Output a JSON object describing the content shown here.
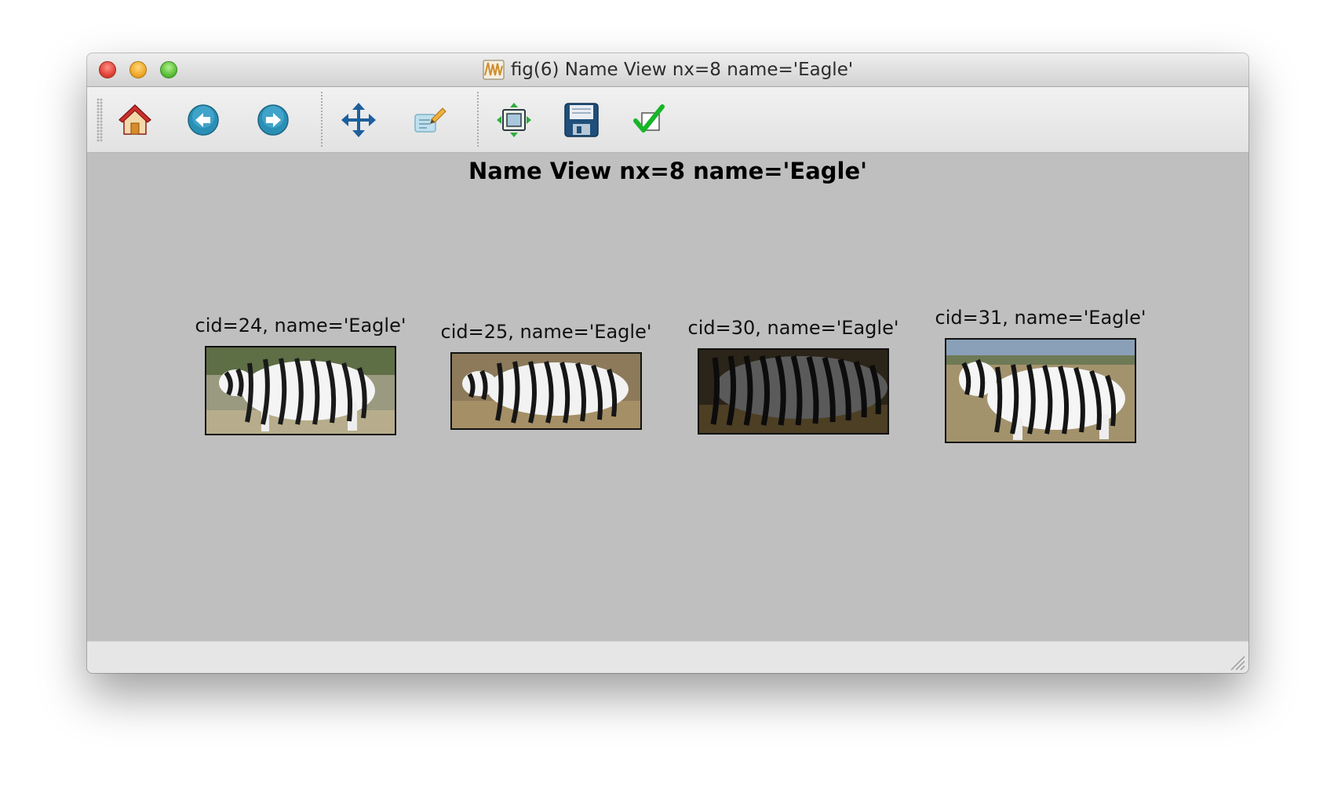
{
  "window": {
    "title": "fig(6) Name View nx=8 name='Eagle'"
  },
  "toolbar": {
    "buttons": [
      {
        "name": "home-icon",
        "tooltip": "Home"
      },
      {
        "name": "back-arrow-icon",
        "tooltip": "Back"
      },
      {
        "name": "forward-arrow-icon",
        "tooltip": "Forward"
      },
      {
        "name": "pan-move-icon",
        "tooltip": "Pan"
      },
      {
        "name": "zoom-rect-icon",
        "tooltip": "Zoom"
      },
      {
        "name": "subplots-configure-icon",
        "tooltip": "Configure subplots"
      },
      {
        "name": "save-floppy-icon",
        "tooltip": "Save"
      },
      {
        "name": "edit-checkmark-icon",
        "tooltip": "Edit"
      }
    ]
  },
  "figure": {
    "title": "Name View nx=8 name='Eagle'",
    "chips": [
      {
        "label": "cid=24, name='Eagle'",
        "image": "zebra-photo"
      },
      {
        "label": "cid=25, name='Eagle'",
        "image": "zebra-photo"
      },
      {
        "label": "cid=30, name='Eagle'",
        "image": "zebra-photo-dark"
      },
      {
        "label": "cid=31, name='Eagle'",
        "image": "zebra-photo"
      }
    ]
  },
  "colors": {
    "canvas_bg": "#bfbfbf",
    "statusbar_bg": "#e6e6e6"
  }
}
